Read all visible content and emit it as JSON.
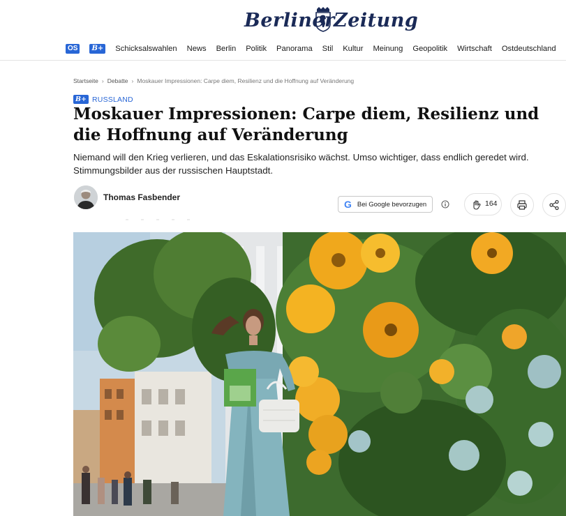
{
  "header": {
    "logo_left": "Berliner",
    "logo_right": "Zeitung",
    "nav_badge_os": "OS",
    "nav_badge_bplus": "B+",
    "nav": [
      "Schicksalswahlen",
      "News",
      "Berlin",
      "Politik",
      "Panorama",
      "Stil",
      "Kultur",
      "Meinung",
      "Geopolitik",
      "Wirtschaft",
      "Ostdeutschland"
    ]
  },
  "breadcrumb": {
    "home": "Startseite",
    "section": "Debatte",
    "current": "Moskauer Impressionen: Carpe diem, Resilienz und die Hoffnung auf Veränderung"
  },
  "article": {
    "badge": "B+",
    "kicker": "RUSSLAND",
    "title": "Moskauer Impressionen: Carpe diem, Resilienz und die Hoffnung auf Veränderung",
    "lead": "Niemand will den Krieg verlieren, und das Eskalationsrisiko wächst. Umso wichtiger, dass endlich geredet wird. Stimmungsbilder aus der russischen Hauptstadt.",
    "author": "Thomas Fasbender"
  },
  "actions": {
    "google_label": "Bei Google bevorzugen",
    "clap_count": "164"
  },
  "icons": {
    "google": "google-g-icon",
    "info": "info-icon",
    "clap": "clap-hand-icon",
    "print": "printer-icon",
    "share": "share-icon"
  },
  "colors": {
    "accent": "#2866d6",
    "logo": "#1a2a57"
  }
}
